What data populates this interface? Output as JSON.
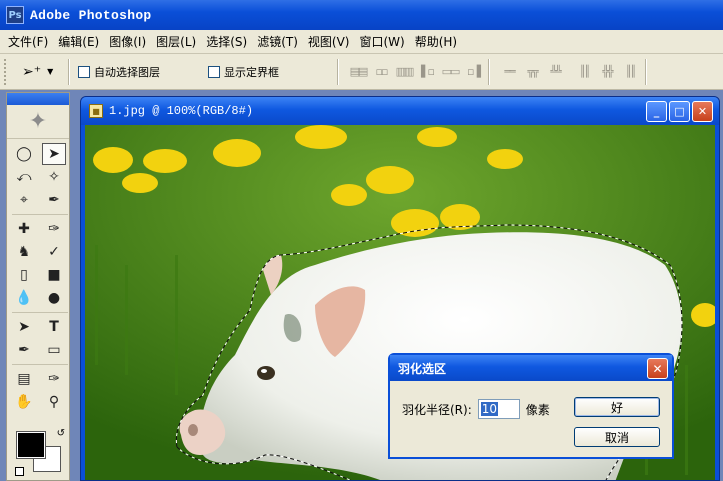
{
  "app": {
    "title": "Adobe Photoshop",
    "logo": "Ps"
  },
  "menu": [
    "文件(F)",
    "编辑(E)",
    "图像(I)",
    "图层(L)",
    "选择(S)",
    "滤镜(T)",
    "视图(V)",
    "窗口(W)",
    "帮助(H)"
  ],
  "options": {
    "tool_icon": "move-tool-icon",
    "auto_select_label": "自动选择图层",
    "show_bounds_label": "显示定界框"
  },
  "document": {
    "title": "1.jpg @ 100%(RGB/8#)"
  },
  "dialog": {
    "title": "羽化选区",
    "radius_label": "羽化半径(R):",
    "radius_value": "10",
    "unit": "像素",
    "ok_label": "好",
    "cancel_label": "取消"
  },
  "colors": {
    "foreground": "#000000",
    "background": "#ffffff",
    "title_blue": "#0a4fd8"
  }
}
